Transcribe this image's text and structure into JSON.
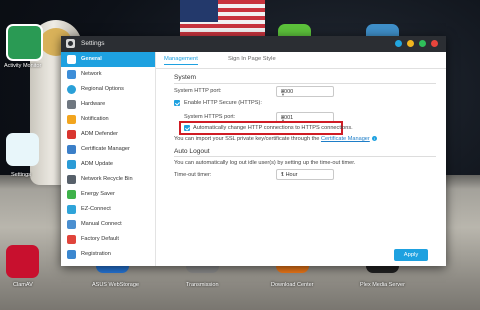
{
  "desktop": {
    "icons": [
      {
        "label": "Activity Monitor"
      },
      {
        "label": "Settings"
      },
      {
        "label": "ClamAV"
      },
      {
        "label": "ASUS WebStorage"
      },
      {
        "label": "Transmission"
      },
      {
        "label": "Download Center"
      },
      {
        "label": "Plex Media Server"
      }
    ]
  },
  "window": {
    "title": "Settings",
    "sidebar": [
      {
        "label": "General",
        "icon": "gear-icon"
      },
      {
        "label": "Network",
        "icon": "network-icon"
      },
      {
        "label": "Regional Options",
        "icon": "globe-icon"
      },
      {
        "label": "Hardware",
        "icon": "hardware-icon"
      },
      {
        "label": "Notification",
        "icon": "bell-icon"
      },
      {
        "label": "ADM Defender",
        "icon": "shield-icon"
      },
      {
        "label": "Certificate Manager",
        "icon": "certificate-icon"
      },
      {
        "label": "ADM Update",
        "icon": "update-icon"
      },
      {
        "label": "Network Recycle Bin",
        "icon": "recycle-icon"
      },
      {
        "label": "Energy Saver",
        "icon": "leaf-icon"
      },
      {
        "label": "EZ-Connect",
        "icon": "link-icon"
      },
      {
        "label": "Manual Connect",
        "icon": "plug-icon"
      },
      {
        "label": "Factory Default",
        "icon": "reset-icon"
      },
      {
        "label": "Registration",
        "icon": "register-icon"
      }
    ],
    "tabs": [
      {
        "label": "Management"
      },
      {
        "label": "Sign In Page Style"
      }
    ],
    "system": {
      "title": "System",
      "http_port_label": "System HTTP port:",
      "http_port": "8000",
      "enable_https_label": "Enable HTTP Secure (HTTPS):",
      "https_port_label": "System HTTPS port:",
      "https_port": "8001",
      "auto_redirect_label": "Automatically change HTTP connections to HTTPS connections.",
      "import_text": "You can import your SSL private key/certificate through the ",
      "import_link": "Certificate Manager"
    },
    "autologout": {
      "title": "Auto Logout",
      "description": "You can automatically log out idle user(s) by setting up the time-out timer.",
      "timer_label": "Time-out timer:",
      "timer_value": "1 Hour"
    },
    "apply_label": "Apply"
  }
}
